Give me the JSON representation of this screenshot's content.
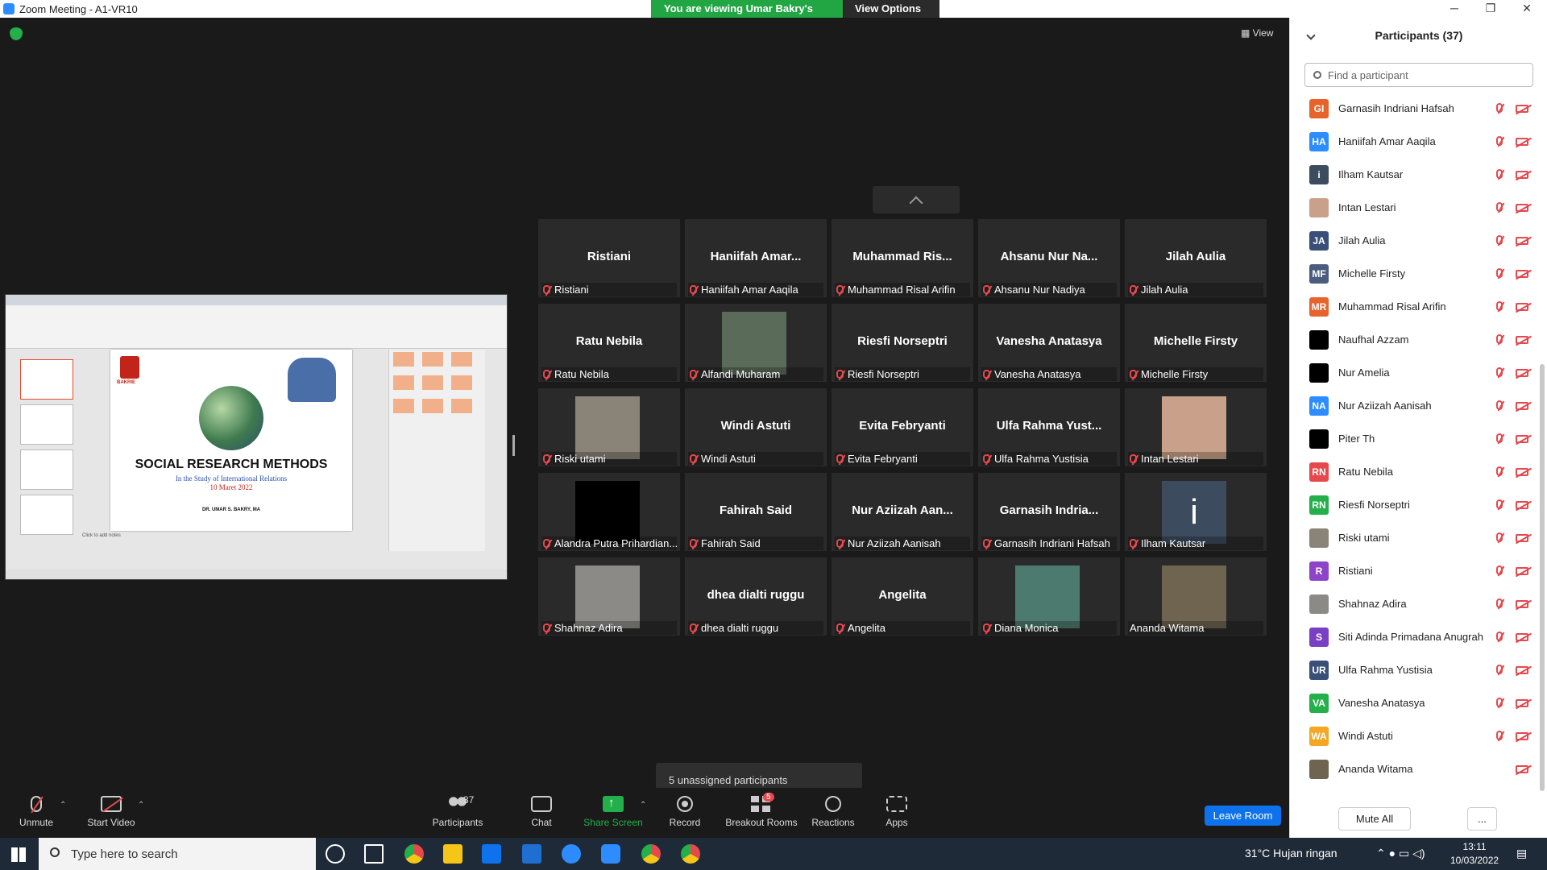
{
  "window": {
    "title": "Zoom Meeting - A1-VR10",
    "minimize": "─",
    "restore": "❐",
    "close": "✕"
  },
  "banner": {
    "viewing": "You are viewing Umar Bakry's screen",
    "view_options": "View Options ⌄"
  },
  "view_button": "▦ View",
  "shared_slide": {
    "university": "BAKRIE",
    "title": "SOCIAL RESEARCH METHODS",
    "subtitle": "In the Study of International Relations",
    "date": "10 Maret 2022",
    "author": "DR. UMAR S. BAKRY, MA",
    "notes_hint": "Click to add notes"
  },
  "video_tiles": [
    {
      "name": "Ristiani",
      "label": "Ristiani",
      "photo": false
    },
    {
      "name": "Haniifah Amar...",
      "label": "Haniifah Amar Aaqila",
      "photo": false
    },
    {
      "name": "Muhammad Ris...",
      "label": "Muhammad Risal Arifin",
      "photo": false
    },
    {
      "name": "Ahsanu Nur Na...",
      "label": "Ahsanu Nur Nadiya",
      "photo": false
    },
    {
      "name": "Jilah Aulia",
      "label": "Jilah Aulia",
      "photo": false
    },
    {
      "name": "Ratu Nebila",
      "label": "Ratu Nebila",
      "photo": false
    },
    {
      "name": "",
      "label": "Alfandi Muharam",
      "photo": true,
      "photo_color": "#5a6b5a"
    },
    {
      "name": "Riesfi Norseptri",
      "label": "Riesfi Norseptri",
      "photo": false
    },
    {
      "name": "Vanesha Anatasya",
      "label": "Vanesha Anatasya",
      "photo": false
    },
    {
      "name": "Michelle Firsty",
      "label": "Michelle Firsty",
      "photo": false
    },
    {
      "name": "",
      "label": "Riski utami",
      "photo": true,
      "photo_color": "#8a8478"
    },
    {
      "name": "Windi Astuti",
      "label": "Windi Astuti",
      "photo": false
    },
    {
      "name": "Evita Febryanti",
      "label": "Evita Febryanti",
      "photo": false
    },
    {
      "name": "Ulfa Rahma Yust...",
      "label": "Ulfa Rahma Yustisia",
      "photo": false
    },
    {
      "name": "",
      "label": "Intan Lestari",
      "photo": true,
      "photo_color": "#c9a08a"
    },
    {
      "name": "",
      "label": "Alandra Putra Prihardian...",
      "photo": true,
      "photo_color": "#000000"
    },
    {
      "name": "Fahirah Said",
      "label": "Fahirah Said",
      "photo": false
    },
    {
      "name": "Nur Aziizah Aan...",
      "label": "Nur Aziizah Aanisah",
      "photo": false
    },
    {
      "name": "Garnasih Indria...",
      "label": "Garnasih Indriani Hafsah",
      "photo": false
    },
    {
      "name": "",
      "label": "Ilham Kautsar",
      "photo": true,
      "photo_color": "#3c4b5e",
      "photo_text": "i"
    },
    {
      "name": "",
      "label": "Shahnaz Adira",
      "photo": true,
      "photo_color": "#8c8a86"
    },
    {
      "name": "dhea dialti ruggu",
      "label": "dhea dialti ruggu",
      "photo": false
    },
    {
      "name": "Angelita",
      "label": "Angelita",
      "photo": false
    },
    {
      "name": "",
      "label": "Diana Monica",
      "photo": true,
      "photo_color": "#4d7a6e"
    },
    {
      "name": "",
      "label": "Ananda Witama",
      "photo": true,
      "photo_color": "#6e6450",
      "muted": false
    }
  ],
  "unassigned": "5 unassigned participants",
  "toolbar": {
    "unmute": "Unmute",
    "start_video": "Start Video",
    "participants": "Participants",
    "participants_count": "37",
    "chat": "Chat",
    "share_screen": "Share Screen",
    "record": "Record",
    "breakout_rooms": "Breakout Rooms",
    "breakout_badge": "5",
    "reactions": "Reactions",
    "apps": "Apps",
    "leave_room": "Leave Room",
    "caret": "⌃"
  },
  "panel": {
    "title": "Participants (37)",
    "search_placeholder": "Find a participant",
    "mute_all": "Mute All",
    "more": "...",
    "participants": [
      {
        "initials": "GI",
        "name": "Garnasih Indriani Hafsah",
        "color": "#e8632b"
      },
      {
        "initials": "HA",
        "name": "Haniifah Amar Aaqila",
        "color": "#2d8cff"
      },
      {
        "initials": "i",
        "name": "Ilham Kautsar",
        "color": "#3c4b5e"
      },
      {
        "initials": "",
        "name": "Intan Lestari",
        "color": "#c9a08a"
      },
      {
        "initials": "JA",
        "name": "Jilah Aulia",
        "color": "#3a4f78"
      },
      {
        "initials": "MF",
        "name": "Michelle Firsty",
        "color": "#4a5d7e"
      },
      {
        "initials": "MR",
        "name": "Muhammad Risal Arifin",
        "color": "#e8632b"
      },
      {
        "initials": "",
        "name": "Naufhal Azzam",
        "color": "#000000"
      },
      {
        "initials": "",
        "name": "Nur Amelia",
        "color": "#000000"
      },
      {
        "initials": "NA",
        "name": "Nur Aziizah Aanisah",
        "color": "#2d8cff"
      },
      {
        "initials": "",
        "name": "Piter Th",
        "color": "#000000"
      },
      {
        "initials": "RN",
        "name": "Ratu Nebila",
        "color": "#e5484d"
      },
      {
        "initials": "RN",
        "name": "Riesfi Norseptri",
        "color": "#23b04b"
      },
      {
        "initials": "",
        "name": "Riski utami",
        "color": "#8a8478"
      },
      {
        "initials": "R",
        "name": "Ristiani",
        "color": "#8e44c9"
      },
      {
        "initials": "",
        "name": "Shahnaz Adira",
        "color": "#8c8a86"
      },
      {
        "initials": "S",
        "name": "Siti Adinda Primadana Anugrah",
        "color": "#7b3fc4"
      },
      {
        "initials": "UR",
        "name": "Ulfa Rahma Yustisia",
        "color": "#3a4f78"
      },
      {
        "initials": "VA",
        "name": "Vanesha Anatasya",
        "color": "#23b04b"
      },
      {
        "initials": "WA",
        "name": "Windi Astuti",
        "color": "#f5a623"
      },
      {
        "initials": "",
        "name": "Ananda Witama",
        "color": "#6e6450"
      }
    ]
  },
  "taskbar": {
    "search_placeholder": "Type here to search",
    "weather": "31°C  Hujan ringan",
    "time": "13:11",
    "date": "10/03/2022"
  }
}
